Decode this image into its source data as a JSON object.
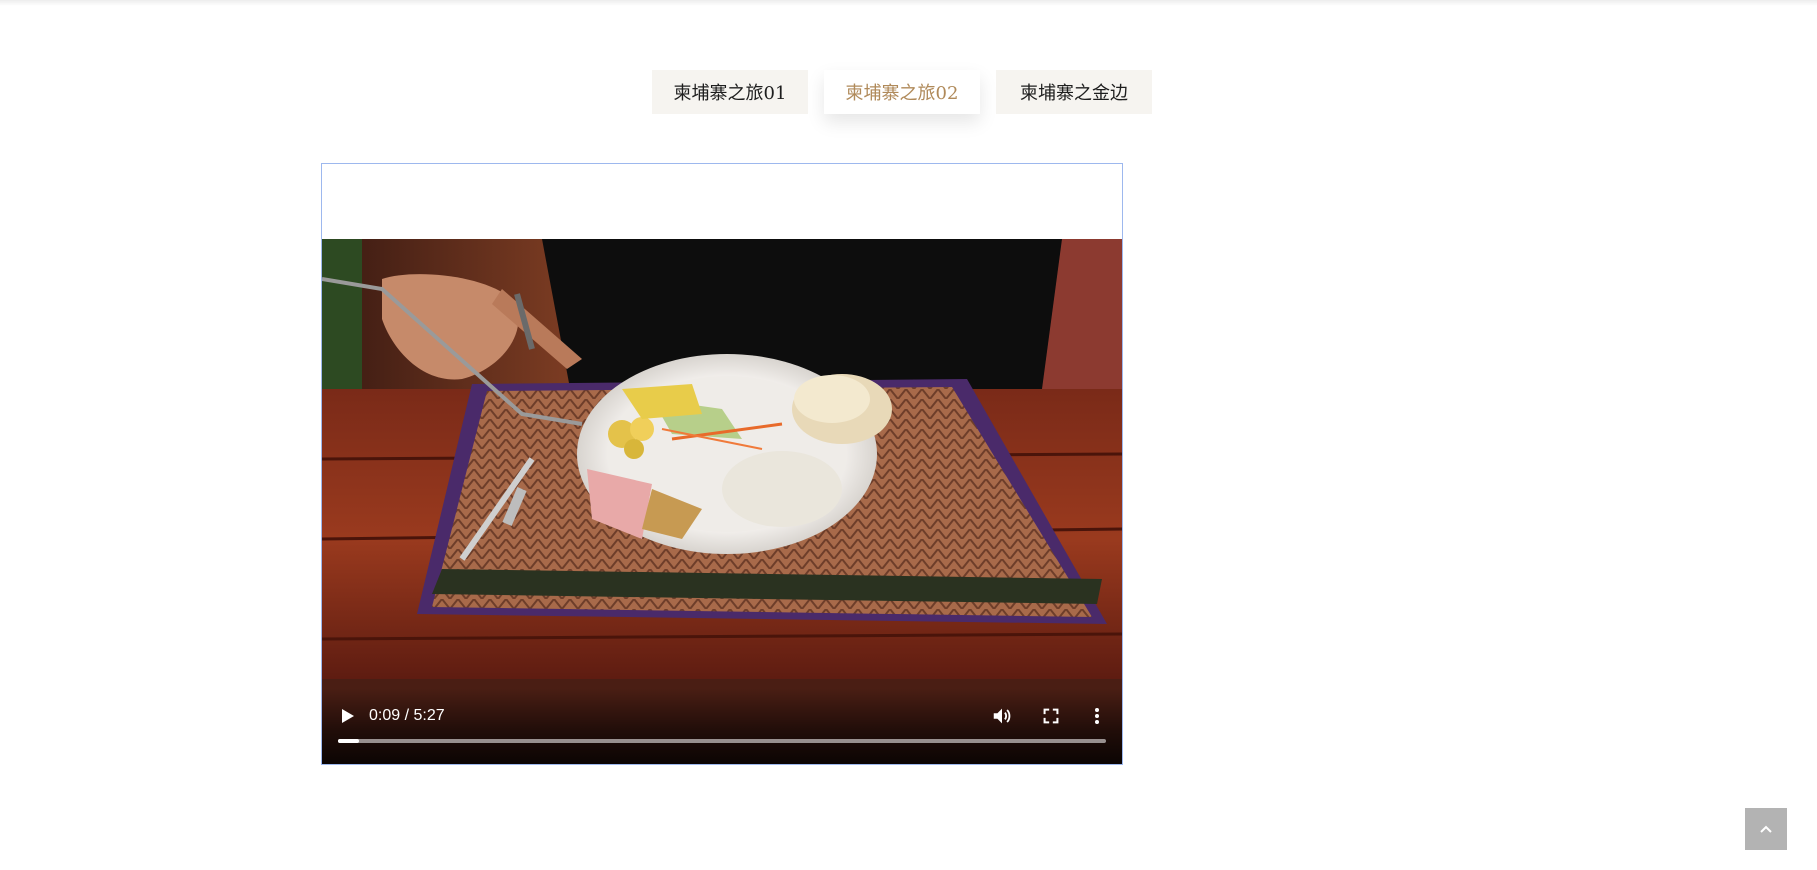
{
  "tabs": [
    {
      "label": "柬埔寨之旅01",
      "active": false
    },
    {
      "label": "柬埔寨之旅02",
      "active": true
    },
    {
      "label": "柬埔寨之金边",
      "active": false
    }
  ],
  "video": {
    "current_time": "0:09",
    "duration": "5:27",
    "time_display": "0:09 / 5:27",
    "progress_fraction": 0.0275,
    "controls": {
      "play_icon": "play-icon",
      "volume_icon": "volume-icon",
      "fullscreen_icon": "fullscreen-icon",
      "more_icon": "more-vert-icon"
    }
  },
  "back_to_top_icon": "chevron-up-icon",
  "colors": {
    "tab_active_text": "#b08a5a",
    "tab_bg": "#f6f4f0",
    "video_border": "#9db8ee",
    "back_to_top_bg": "#b3b3b3"
  }
}
